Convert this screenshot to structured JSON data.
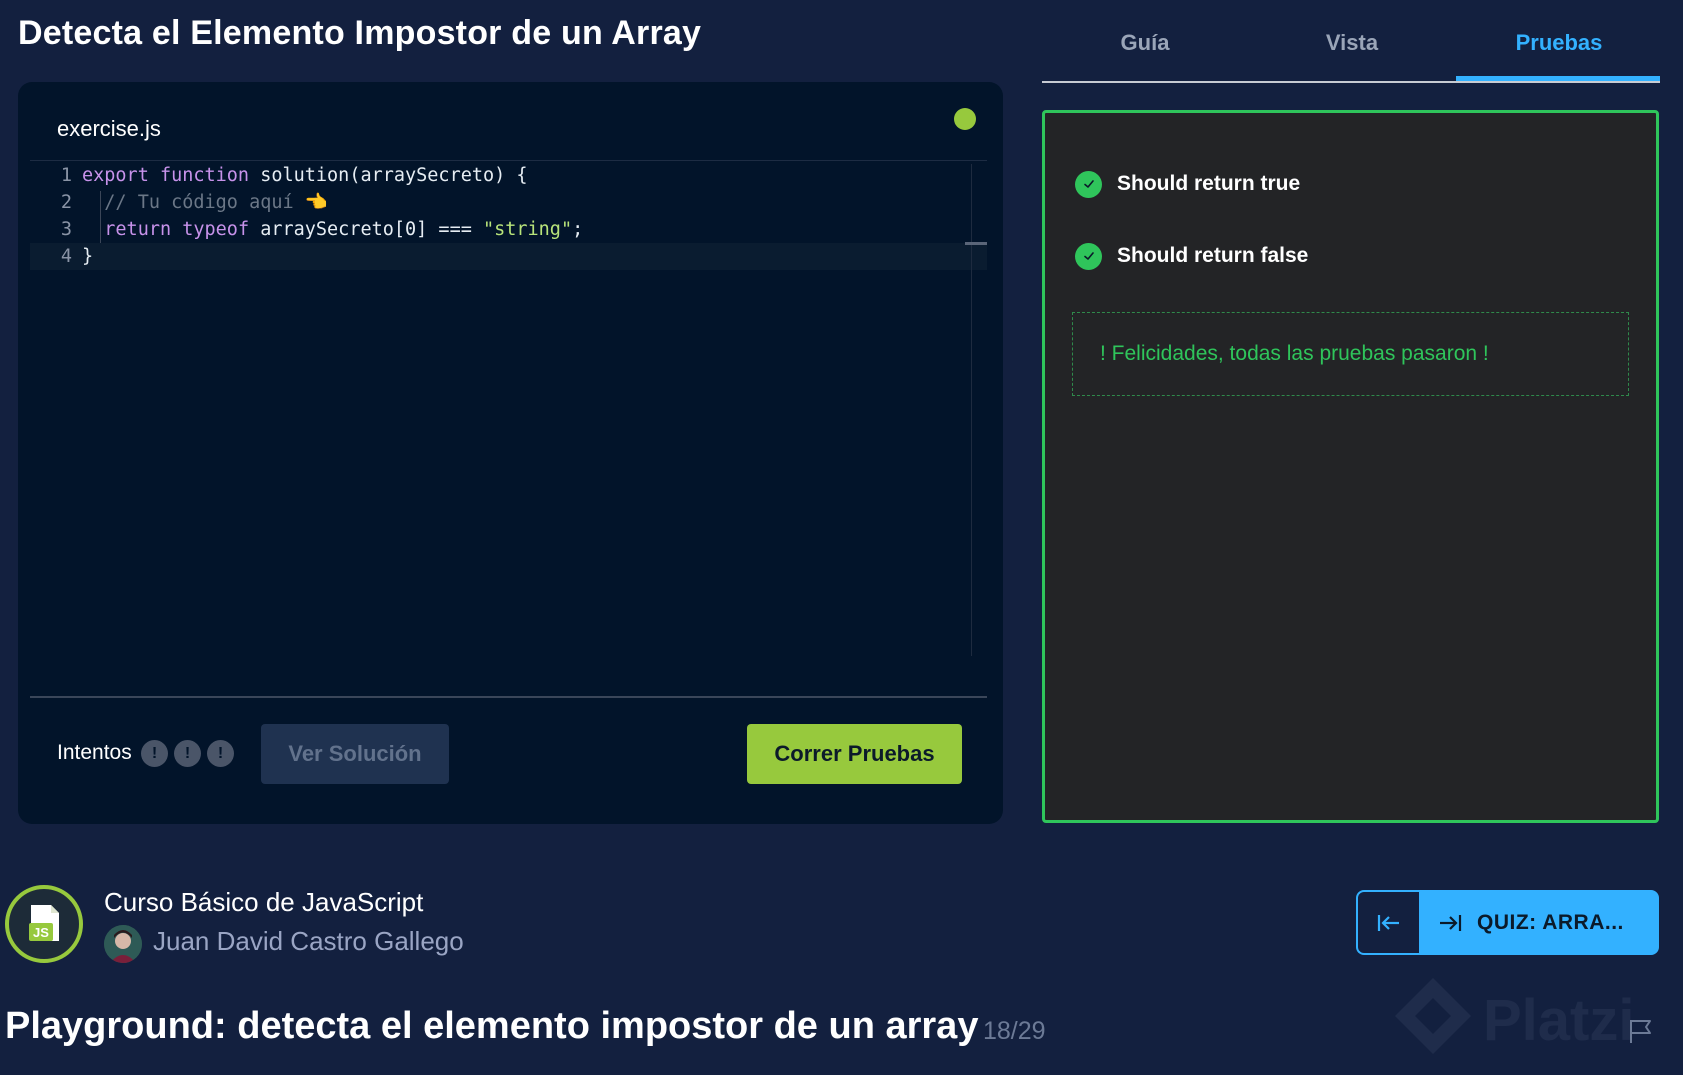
{
  "page_title": "Detecta el Elemento Impostor de un Array",
  "editor": {
    "file_name": "exercise.js",
    "status_color": "#97c93d",
    "code_lines": [
      {
        "number": "1",
        "parts": [
          [
            "kw",
            "export "
          ],
          [
            "kw",
            "function "
          ],
          [
            "fn",
            "solution"
          ],
          [
            "pl",
            "(arraySecreto) {"
          ]
        ]
      },
      {
        "number": "2",
        "parts": [
          [
            "pl",
            "  "
          ],
          [
            "cm",
            "// Tu código aquí 👈"
          ]
        ]
      },
      {
        "number": "3",
        "parts": [
          [
            "pl",
            "  "
          ],
          [
            "kw",
            "return "
          ],
          [
            "kw",
            "typeof "
          ],
          [
            "pl",
            "arraySecreto[0] === "
          ],
          [
            "str",
            "\"string\""
          ],
          [
            "pl",
            ";"
          ]
        ]
      },
      {
        "number": "4",
        "parts": [
          [
            "pl",
            "}"
          ]
        ]
      }
    ],
    "attempts_label": "Intentos",
    "attempt_marks": [
      "!",
      "!",
      "!"
    ],
    "solution_button": "Ver Solución",
    "run_button": "Correr Pruebas"
  },
  "tabs": [
    {
      "label": "Guía",
      "active": false
    },
    {
      "label": "Vista",
      "active": false
    },
    {
      "label": "Pruebas",
      "active": true
    }
  ],
  "tests": {
    "results": [
      {
        "label": "Should return true",
        "status": "passed"
      },
      {
        "label": "Should return false",
        "status": "passed"
      }
    ],
    "success_message": "! Felicidades, todas las pruebas pasaron !"
  },
  "course": {
    "logo_text": "JS",
    "name": "Curso Básico de JavaScript",
    "teacher": "Juan David Castro Gallego"
  },
  "navigation": {
    "prev_icon": "arrow-left-to-line-icon",
    "next_icon": "arrow-right-to-line-icon",
    "next_label": "QUIZ: ARRA..."
  },
  "lesson": {
    "title": "Playground: detecta el elemento impostor de un array",
    "counter": "18/29"
  },
  "watermark": "Platzi",
  "colors": {
    "background": "#13203f",
    "accent_blue": "#33b1ff",
    "accent_green": "#97c93d",
    "success_green": "#2fc55b"
  }
}
